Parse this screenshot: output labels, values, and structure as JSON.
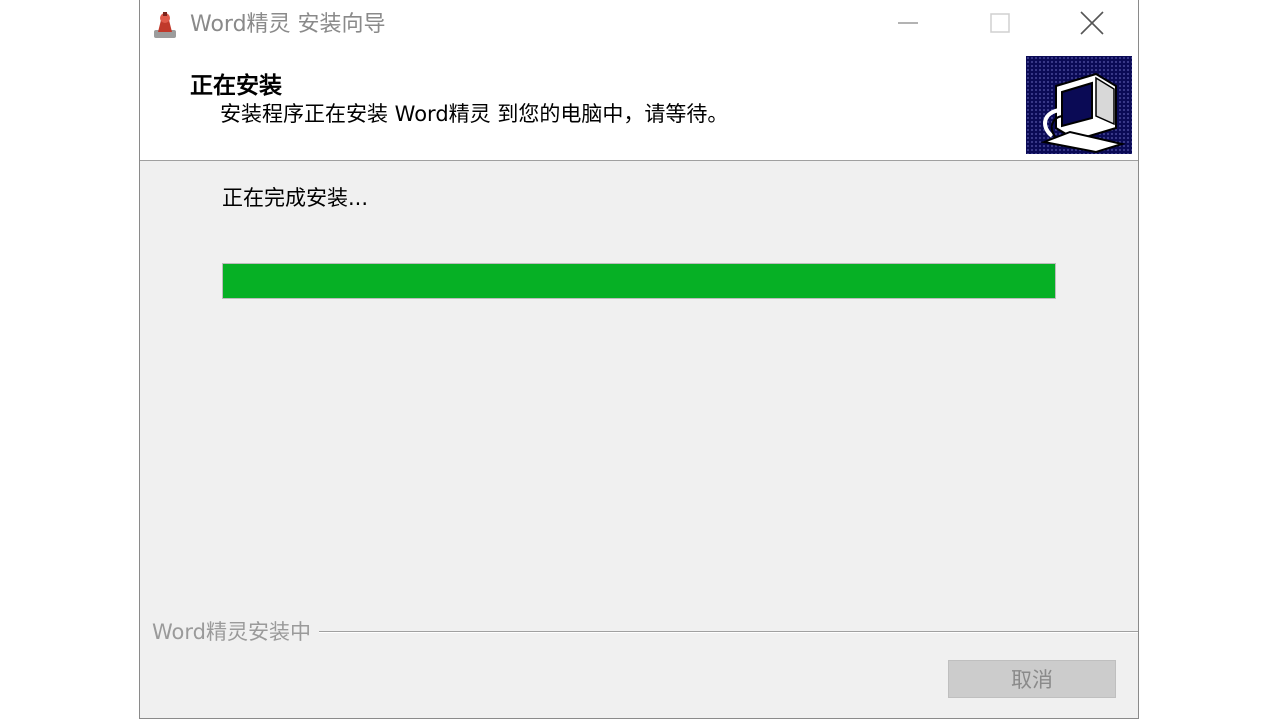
{
  "window": {
    "title": "Word精灵 安装向导"
  },
  "controls": {
    "minimize_icon": "minimize-icon",
    "maximize_icon": "maximize-icon",
    "close_icon": "close-icon"
  },
  "header": {
    "title": "正在安装",
    "subtitle": "安装程序正在安装 Word精灵 到您的电脑中，请等待。",
    "logo_icon": "computer-install-icon"
  },
  "main": {
    "status": "正在完成安装...",
    "progress_fraction": 1.0,
    "progress_color": "#06b025"
  },
  "footer": {
    "brand": "Word精灵安装中",
    "cancel_label": "取消"
  }
}
